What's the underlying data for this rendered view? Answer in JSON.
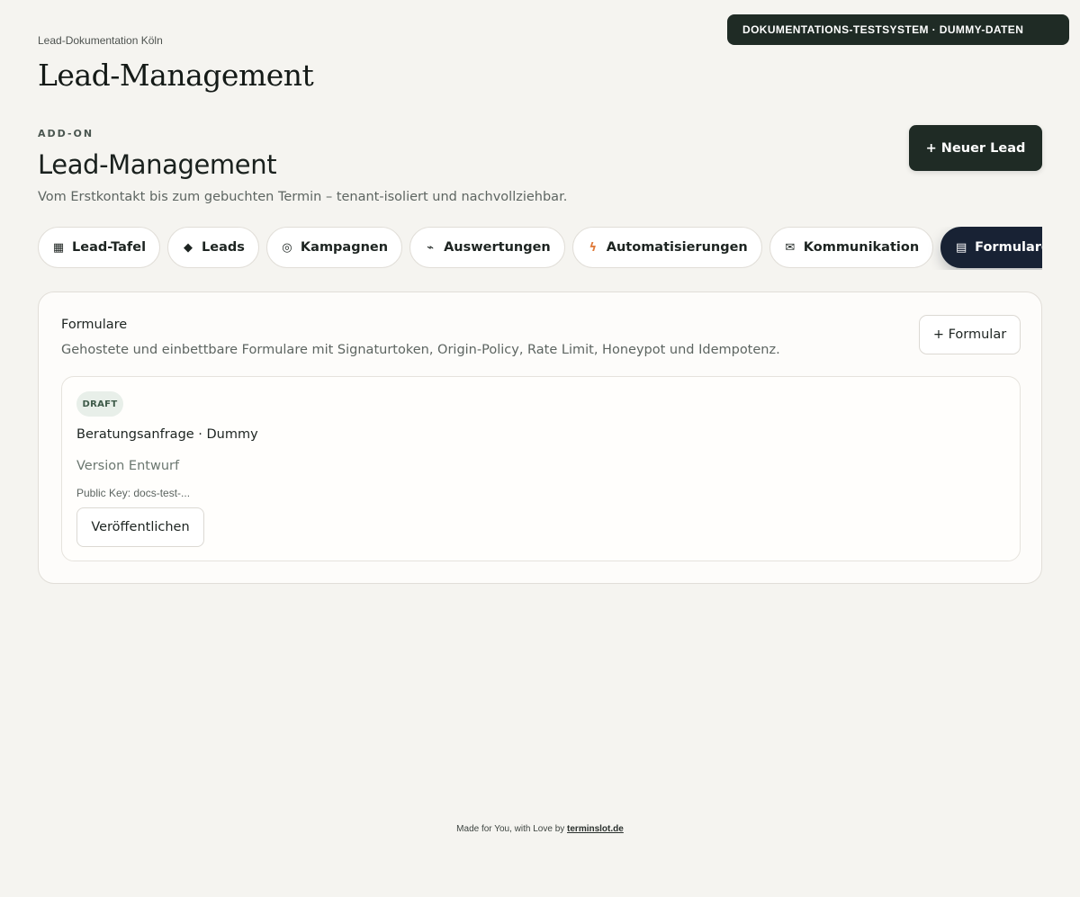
{
  "env_badge": "DOKUMENTATIONS-TESTSYSTEM · DUMMY-DATEN",
  "breadcrumb": "Lead-Dokumentation Köln",
  "page_title": "Lead-Management",
  "header": {
    "eyebrow": "ADD-ON",
    "title": "Lead-Management",
    "subtitle": "Vom Erstkontakt bis zum gebuchten Termin – tenant-isoliert und nachvollziehbar.",
    "new_lead_label": "+ Neuer Lead"
  },
  "tabs": [
    {
      "label": "Lead-Tafel",
      "icon": "▦",
      "icon_name": "grid-icon",
      "active": false
    },
    {
      "label": "Leads",
      "icon": "◆",
      "icon_name": "diamond-icon",
      "active": false
    },
    {
      "label": "Kampagnen",
      "icon": "◎",
      "icon_name": "target-icon",
      "active": false
    },
    {
      "label": "Auswertungen",
      "icon": "⌁",
      "icon_name": "chart-line-icon",
      "active": false
    },
    {
      "label": "Automatisierungen",
      "icon": "ϟ",
      "icon_name": "bolt-icon",
      "active": false
    },
    {
      "label": "Kommunikation",
      "icon": "✉",
      "icon_name": "mail-icon",
      "active": false
    },
    {
      "label": "Formulare",
      "icon": "▤",
      "icon_name": "form-icon",
      "active": true
    },
    {
      "label": "",
      "icon": "⌘",
      "icon_name": "command-icon",
      "active": false
    }
  ],
  "forms_panel": {
    "title": "Formulare",
    "description": "Gehostete und einbettbare Formulare mit Signaturtoken, Origin-Policy, Rate Limit, Honeypot und Idempotenz.",
    "add_button_label": "+ Formular",
    "items": [
      {
        "status": "DRAFT",
        "name": "Beratungsanfrage · Dummy",
        "version": "Version Entwurf",
        "public_key": "Public Key: docs-test-...",
        "publish_label": "Veröffentlichen"
      }
    ]
  },
  "footer": {
    "text": "Made for You, with Love by",
    "link": "terminslot.de"
  },
  "colors": {
    "background": "#f5f4f0",
    "dark_button": "#1f2b25",
    "active_tab": "#182234",
    "draft_badge_bg": "#e8efe9",
    "bolt_icon": "#e07b3b"
  }
}
